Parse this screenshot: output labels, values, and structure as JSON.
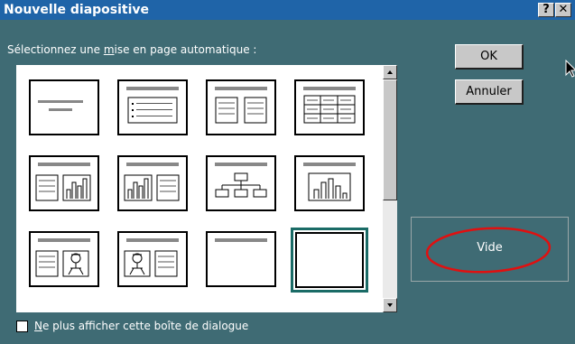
{
  "window": {
    "title": "Nouvelle diapositive",
    "help_label": "?",
    "close_label": "✕"
  },
  "prompt": {
    "before": "Sélectionnez une ",
    "underlined": "m",
    "after": "ise en page automatique :"
  },
  "layouts": [
    {
      "icon": "title-slide-icon"
    },
    {
      "icon": "bulleted-list-icon"
    },
    {
      "icon": "two-column-text-icon"
    },
    {
      "icon": "table-icon"
    },
    {
      "icon": "text-and-chart-icon"
    },
    {
      "icon": "chart-and-text-icon"
    },
    {
      "icon": "organization-chart-icon"
    },
    {
      "icon": "chart-icon"
    },
    {
      "icon": "text-and-clip-art-icon"
    },
    {
      "icon": "clip-art-and-text-icon"
    },
    {
      "icon": "title-only-icon"
    },
    {
      "icon": "blank-icon"
    }
  ],
  "selected_layout": "Vide",
  "buttons": {
    "ok": "OK",
    "cancel": "Annuler"
  },
  "checkbox": {
    "underlined": "N",
    "rest": "e plus afficher cette boîte de dialogue",
    "checked": false
  },
  "colors": {
    "background": "#3f6b74",
    "titlebar": "#1f64a8",
    "selection_border": "#1a6b66",
    "annotation": "#e01010"
  }
}
